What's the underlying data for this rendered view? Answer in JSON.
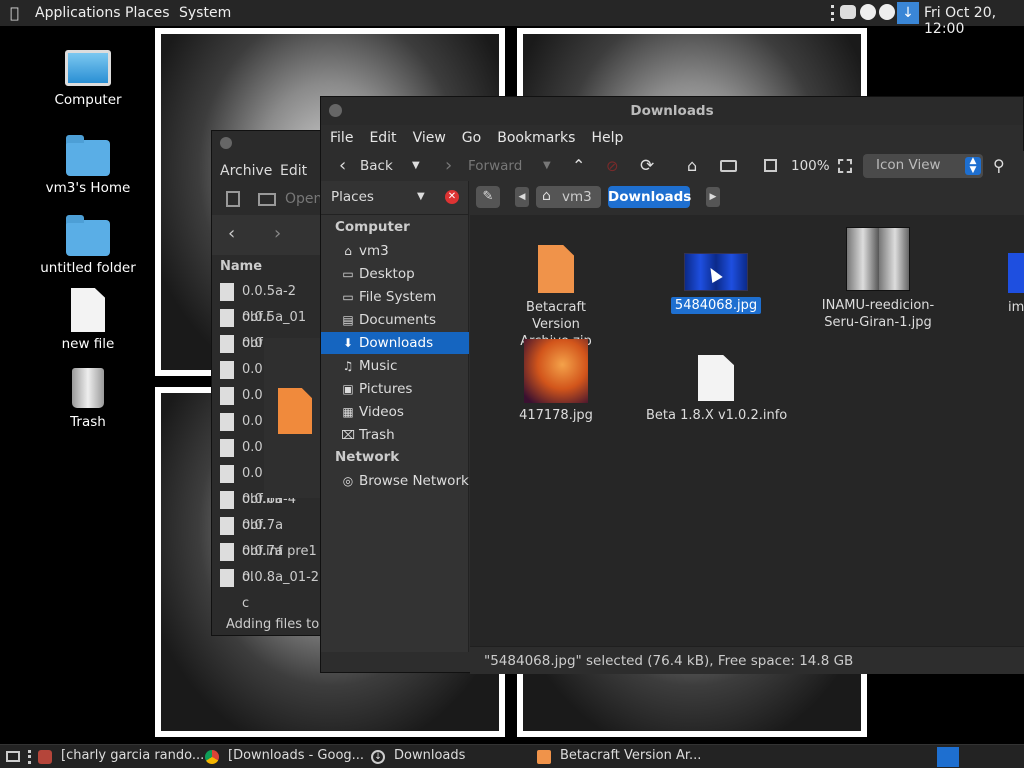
{
  "top_panel": {
    "menus": [
      "Applications",
      "Places",
      "System"
    ],
    "clock": "Fri Oct 20, 12:00"
  },
  "desktop": {
    "icons": [
      {
        "label": "Computer",
        "icon": "computer-icon"
      },
      {
        "label": "vm3's Home",
        "icon": "home-folder-icon"
      },
      {
        "label": "untitled folder",
        "icon": "folder-icon"
      },
      {
        "label": "new file",
        "icon": "file-icon"
      },
      {
        "label": "Trash",
        "icon": "trash-icon"
      }
    ]
  },
  "archive_window": {
    "menus": [
      "Archive",
      "Edit"
    ],
    "open_label": "Open",
    "column_name": "Name",
    "files": [
      "0.0.5a-2 obf.i",
      "0.0.5a_01 obf",
      "0.0",
      "0.0",
      "0.0",
      "0.0",
      "0.0",
      "0.0.5a obf.inf",
      "0.0.6a-4 obf.",
      "0.0.7a obf.inf",
      "0.0.7a pre1 ol",
      "0.0.8a_01-2 c"
    ],
    "status": "Adding files to \""
  },
  "file_manager": {
    "title": "Downloads",
    "menus": [
      "File",
      "Edit",
      "View",
      "Go",
      "Bookmarks",
      "Help"
    ],
    "toolbar": {
      "back": "Back",
      "forward": "Forward",
      "zoom": "100%",
      "view_mode": "Icon View"
    },
    "sidebar": {
      "header": "Places",
      "sections": [
        {
          "title": "Computer",
          "items": [
            {
              "label": "vm3",
              "icon": "home-icon"
            },
            {
              "label": "Desktop",
              "icon": "desktop-icon"
            },
            {
              "label": "File System",
              "icon": "drive-icon"
            },
            {
              "label": "Documents",
              "icon": "documents-icon"
            },
            {
              "label": "Downloads",
              "icon": "download-icon",
              "selected": true
            },
            {
              "label": "Music",
              "icon": "music-icon"
            },
            {
              "label": "Pictures",
              "icon": "pictures-icon"
            },
            {
              "label": "Videos",
              "icon": "videos-icon"
            },
            {
              "label": "Trash",
              "icon": "trash-icon"
            }
          ]
        },
        {
          "title": "Network",
          "items": [
            {
              "label": "Browse Network",
              "icon": "network-icon"
            }
          ]
        }
      ]
    },
    "breadcrumb": {
      "home": "vm3",
      "current": "Downloads"
    },
    "files": [
      {
        "label": "Betacraft Version Archive.zip",
        "kind": "zip"
      },
      {
        "label": "5484068.jpg",
        "kind": "image-blue",
        "selected": true
      },
      {
        "label": "INAMU-reedicion-Seru-Giran-1.jpg",
        "kind": "image-bw"
      },
      {
        "label": "im",
        "kind": "image-blue"
      },
      {
        "label": "417178.jpg",
        "kind": "image-orange"
      },
      {
        "label": "Beta 1.8.X v1.0.2.info",
        "kind": "file"
      }
    ],
    "status": "\"5484068.jpg\" selected (76.4 kB), Free space: 14.8 GB"
  },
  "taskbar": {
    "tasks": [
      "[charly garcia rando...",
      "[Downloads - Goog...",
      "Downloads",
      "Betacraft Version Ar..."
    ]
  }
}
